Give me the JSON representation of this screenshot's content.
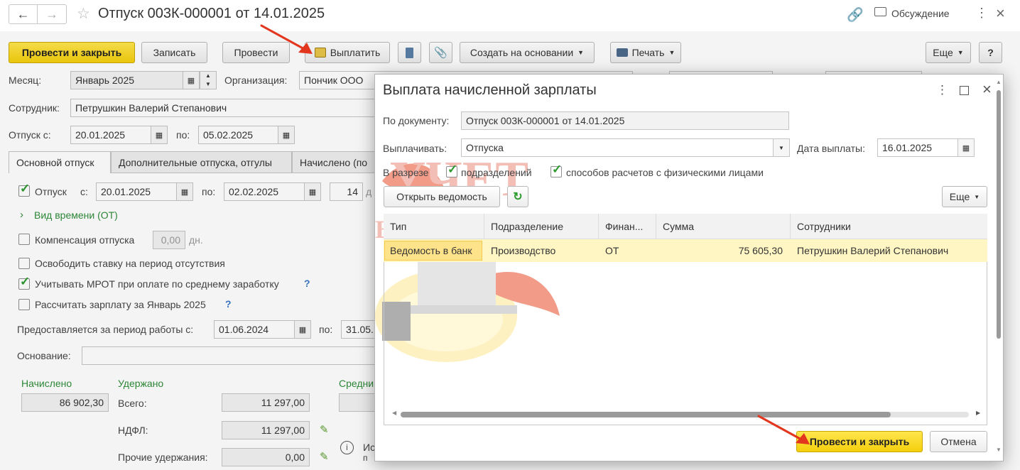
{
  "title": "Отпуск 003К-000001 от 14.01.2025",
  "header": {
    "discussion": "Обсуждение"
  },
  "toolbar": {
    "post_close": "Провести и закрыть",
    "save": "Записать",
    "post": "Провести",
    "pay": "Выплатить",
    "create_basis": "Создать на основании",
    "print": "Печать",
    "more": "Еще",
    "help": "?"
  },
  "form": {
    "month_label": "Месяц:",
    "month_value": "Январь 2025",
    "org_label": "Организация:",
    "org_value": "Пончик ООО",
    "employee_label": "Сотрудник:",
    "employee_value": "Петрушкин Валерий Степанович",
    "vac_from_label": "Отпуск с:",
    "vac_from_value": "20.01.2025",
    "vac_to_label": "по:",
    "vac_to_value": "05.02.2025"
  },
  "tabs": [
    "Основной отпуск",
    "Дополнительные отпуска, отгулы",
    "Начислено (по"
  ],
  "main_tab": {
    "vac_cb_label": "Отпуск",
    "from_label": "с:",
    "from_value": "20.01.2025",
    "to_label": "по:",
    "to_value": "02.02.2025",
    "days_value": "14",
    "days_unit": "д",
    "time_kind": "Вид времени (ОТ)",
    "compensation_label": "Компенсация отпуска",
    "compensation_value": "0,00",
    "compensation_unit": "дн.",
    "free_rate": "Освободить ставку на период отсутствия",
    "mrot": "Учитывать МРОТ при оплате по среднему заработку",
    "calc_salary": "Рассчитать зарплату за Январь 2025",
    "period_label": "Предоставляется за период работы с:",
    "period_from": "01.06.2024",
    "period_to_label": "по:",
    "period_to": "31.05.",
    "basis_label": "Основание:",
    "accrued_label": "Начислено",
    "accrued_value": "86 902,30",
    "withheld_label": "Удержано",
    "total_label": "Всего:",
    "total_value": "11 297,00",
    "ndfl_label": "НДФЛ:",
    "ndfl_value": "11 297,00",
    "other_label": "Прочие удержания:",
    "other_value": "0,00",
    "avg_label": "Средни",
    "info_text1": "Ис",
    "info_text2": "п"
  },
  "modal": {
    "title": "Выплата начисленной зарплаты",
    "doc_label": "По документу:",
    "doc_value": "Отпуск 003К-000001 от 14.01.2025",
    "pay_label": "Выплачивать:",
    "pay_value": "Отпуска",
    "date_label": "Дата выплаты:",
    "date_value": "16.01.2025",
    "breakdown_label": "В разрезе",
    "by_dept": "подразделений",
    "by_method": "способов расчетов с физическими лицами",
    "open_statement": "Открыть ведомость",
    "more": "Еще",
    "columns": [
      "Тип",
      "Подразделение",
      "Финан...",
      "Сумма",
      "Сотрудники"
    ],
    "rows": [
      {
        "type": "Ведомость в банк",
        "dept": "Производство",
        "fin": "ОТ",
        "sum": "75 605,30",
        "emp": "Петрушкин Валерий Степанович"
      }
    ],
    "post_close": "Провести и закрыть",
    "cancel": "Отмена"
  },
  "watermark": {
    "line1": "УЧЕТ",
    "line2": "БЕЗ ЗАБОТ"
  },
  "colors": {
    "accent_yellow": "#f5d215",
    "check_green": "#2d9a2d",
    "arrow_red": "#e2361e",
    "row_highlight": "#fff6c4"
  }
}
